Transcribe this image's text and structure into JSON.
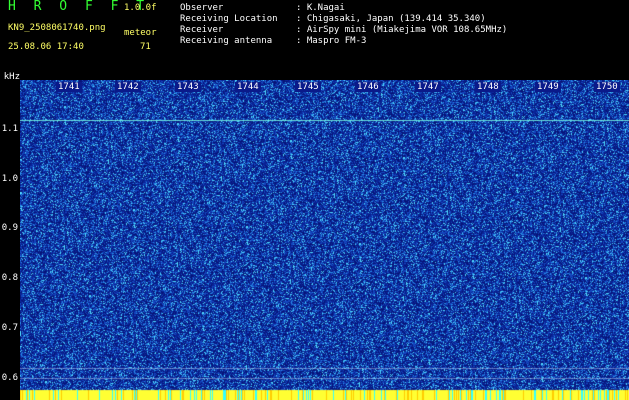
{
  "header": {
    "app_title": "H R O F F T",
    "version": "1.0.0f",
    "filename": "KN9_2508061740.png",
    "meteor_label": "meteor",
    "datetime": "25.08.06 17:40",
    "meteor_count": "71"
  },
  "meta": [
    {
      "label": "Observer",
      "value": ": K.Nagai"
    },
    {
      "label": "Receiving Location",
      "value": ": Chigasaki, Japan (139.414 35.340)"
    },
    {
      "label": "Receiver",
      "value": ": AirSpy mini (Miakejima VOR 108.65MHz)"
    },
    {
      "label": "Receiving antenna",
      "value": ": Maspro FM-3"
    }
  ],
  "axis": {
    "y_unit": "kHz",
    "y_ticks": [
      "1.1",
      "1.0",
      "0.9",
      "0.8",
      "0.7",
      "0.6"
    ],
    "time_ticks": [
      "1741",
      "1742",
      "1743",
      "1744",
      "1745",
      "1746",
      "1747",
      "1748",
      "1749",
      "1750"
    ]
  },
  "colors": {
    "background": "#000000",
    "spectrum_base": "#0a1a8a",
    "noise_high": "#33ccff",
    "trace_line": "#ffff66",
    "meta_text": "#ffffff",
    "title_text": "#33ff33"
  }
}
